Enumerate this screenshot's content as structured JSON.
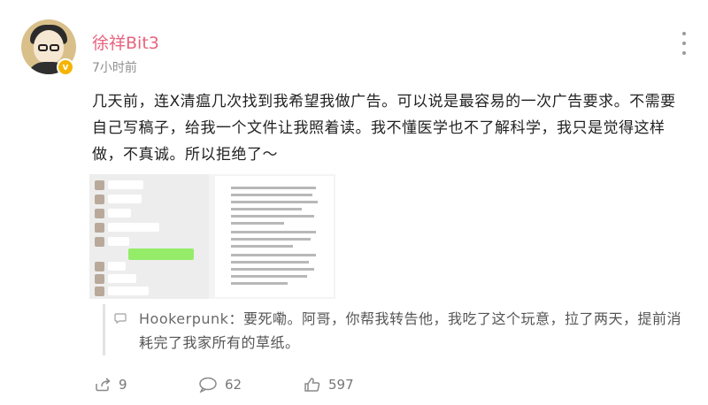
{
  "post": {
    "username": "徐祥Bit3",
    "time": "7小时前",
    "body": "几天前，连X清瘟几次找到我希望我做广告。可以说是最容易的一次广告要求。不需要自己写稿子，给我一个文件让我照着读。我不懂医学也不了解科学，我只是觉得这样做，不真诚。所以拒绝了～",
    "verified_badge": "v"
  },
  "comment": {
    "author": "Hookerpunk",
    "text": "：要死嘞。阿哥，你帮我转告他，我吃了这个玩意，拉了两天，提前消耗完了我家所有的草纸。"
  },
  "stats": {
    "reposts": "9",
    "comments": "62",
    "likes": "597"
  },
  "icons": {
    "more": "more-vertical-icon",
    "repost": "repost-icon",
    "comment": "comment-icon",
    "like": "like-icon",
    "quote": "comment-bubble-icon"
  },
  "colors": {
    "username": "#e8637e",
    "chat_green": "#95ec69",
    "verified": "#f5b400"
  }
}
